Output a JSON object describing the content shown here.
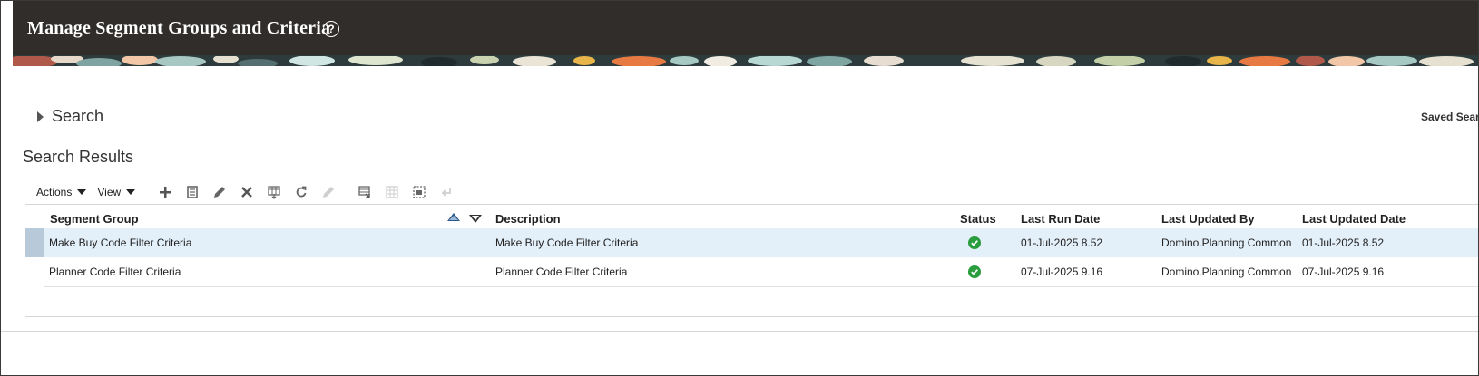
{
  "header": {
    "title": "Manage Segment Groups and Criteria",
    "help_icon": "?"
  },
  "search": {
    "label": "Search",
    "saved_search_label": "Saved Search"
  },
  "results": {
    "title": "Search Results"
  },
  "toolbar": {
    "actions_label": "Actions",
    "view_label": "View",
    "icons": [
      "add-icon",
      "duplicate-icon",
      "edit-icon",
      "delete-icon",
      "export-icon",
      "refresh-icon",
      "disabled-edit-icon",
      "format-icon",
      "freeze-icon",
      "detach-icon",
      "wrap-icon"
    ]
  },
  "table": {
    "columns": {
      "segment_group": "Segment Group",
      "description": "Description",
      "status": "Status",
      "last_run_date": "Last Run Date",
      "last_updated_by": "Last Updated By",
      "last_updated_date": "Last Updated Date"
    },
    "rows": [
      {
        "segment_group": "Make Buy Code Filter Criteria",
        "description": "Make Buy Code Filter Criteria",
        "status": "success",
        "last_run_date": "01-Jul-2025 8.52",
        "last_updated_by": "Domino.Planning Common",
        "last_updated_date": "01-Jul-2025 8.52"
      },
      {
        "segment_group": "Planner Code Filter Criteria",
        "description": "Planner Code Filter Criteria",
        "status": "success",
        "last_run_date": "07-Jul-2025 9.16",
        "last_updated_by": "Domino.Planning Common",
        "last_updated_date": "07-Jul-2025 9.16"
      }
    ]
  },
  "colors": {
    "title_bar": "#312d2a",
    "selected_row": "#e3eff9",
    "status_ok": "#2a9d3e",
    "sort_active": "#2b5a8a"
  }
}
